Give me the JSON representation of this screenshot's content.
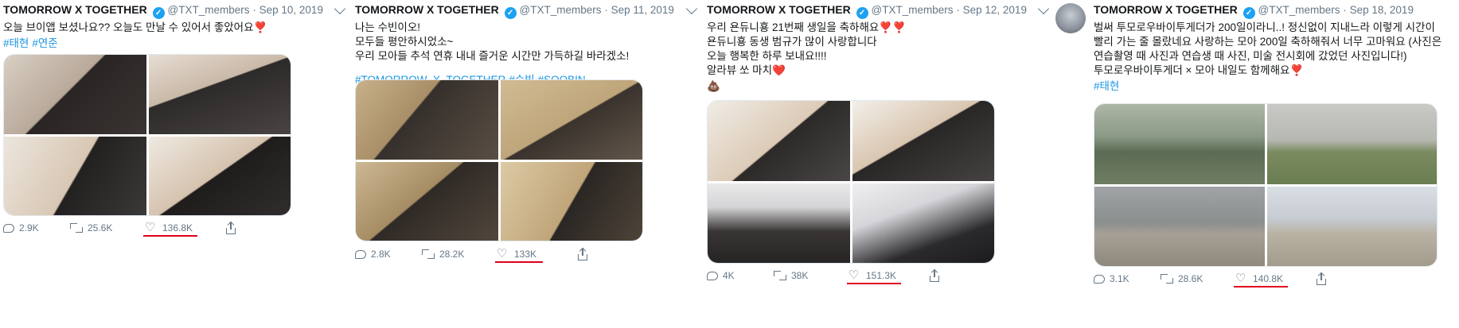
{
  "tweets": [
    {
      "author": "TOMORROW X TOGETHER",
      "handle": "@TXT_members",
      "date": "Sep 10, 2019",
      "text": "오늘 브이앱 보셨나요?? 오늘도 만날 수 있어서 좋았어요",
      "emoji": "❣️",
      "hashtags": [
        "#태현",
        "#연준"
      ],
      "replies": "2.9K",
      "retweets": "25.6K",
      "likes": "136.8K"
    },
    {
      "author": "TOMORROW X TOGETHER",
      "handle": "@TXT_members",
      "date": "Sep 11, 2019",
      "text": "나는 수빈이오!\n모두들 평안하시었소~\n우리 모아들 추석 연휴 내내 즐거운 시간만 가득하길 바라겠소!",
      "emoji": "",
      "hashtags": [
        "#TOMORROW_X_TOGETHER",
        "#수빈",
        "#SOOBIN"
      ],
      "replies": "2.8K",
      "retweets": "28.2K",
      "likes": "133K"
    },
    {
      "author": "TOMORROW X TOGETHER",
      "handle": "@TXT_members",
      "date": "Sep 12, 2019",
      "text": "우리 욘듀니횽 21번째 생일을 축하해요❣️❣️\n욘듀니횽 동생 범규가 많이 사랑합니다\n오늘 행복한 하루 보내요!!!!\n알라뷰 쏘 마치❤️",
      "emoji": "💩",
      "hashtags": [],
      "replies": "4K",
      "retweets": "38K",
      "likes": "151.3K"
    },
    {
      "author": "TOMORROW X TOGETHER",
      "handle": "@TXT_members",
      "date": "Sep 18, 2019",
      "text": "벌써 투모로우바이투게더가 200일이라니..! 정신없이 지내느라 이렇게 시간이 빨리 가는 줄 몰랐네요 사랑하는 모아 200일 축하해줘서 너무 고마워요 (사진은 연습촬영 때 사진과 연습생 때 사진, 미술 전시회에 갔었던 사진입니다!)\n투모로우바이투게더 × 모아 내일도 함께해요❣️",
      "emoji": "",
      "hashtags": [
        "#태현"
      ],
      "replies": "3.1K",
      "retweets": "28.6K",
      "likes": "140.8K"
    }
  ],
  "colors": {
    "link": "#1b95e0",
    "verified": "#1da1f2",
    "muted": "#657786",
    "highlight_underline": "#e0001b"
  }
}
